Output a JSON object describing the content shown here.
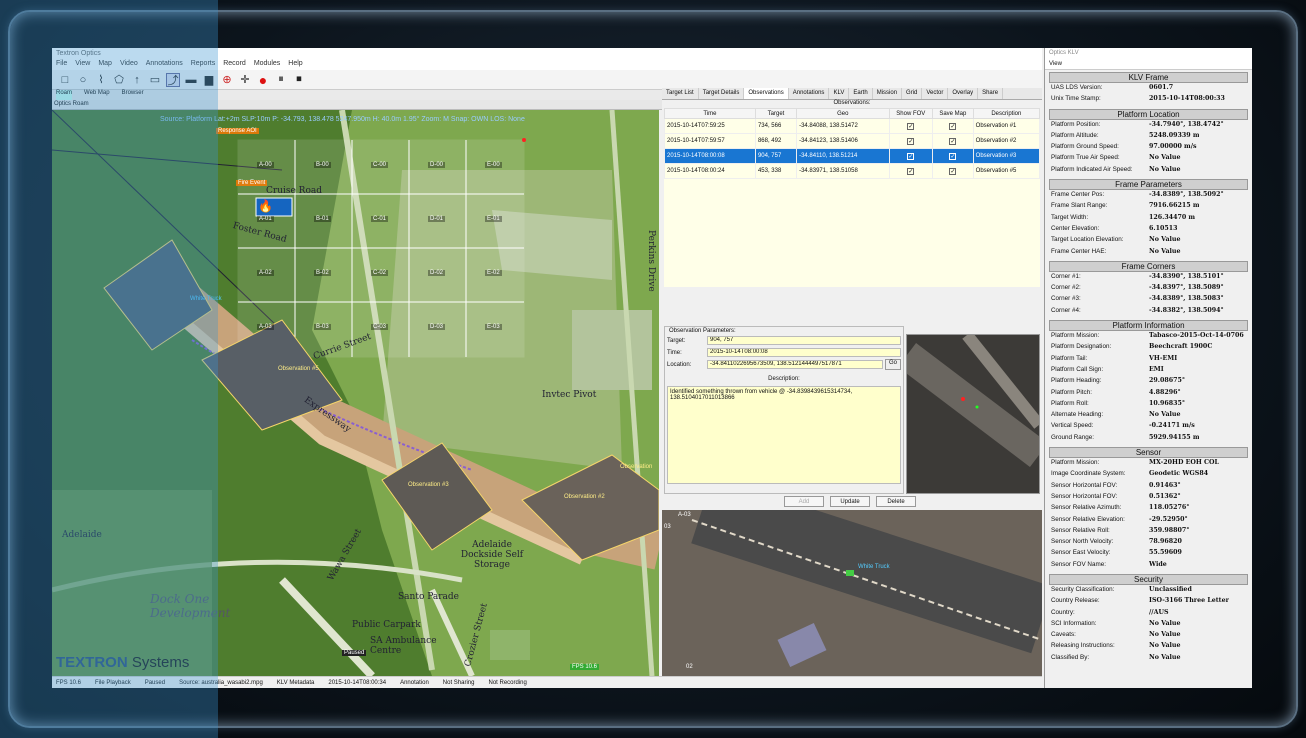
{
  "window": {
    "title": "Textron Optics",
    "menu": [
      "File",
      "View",
      "Map",
      "Video",
      "Annotations",
      "Reports",
      "Record",
      "Modules",
      "Help"
    ],
    "subtabs": [
      "Roam",
      "Web Map",
      "Browser"
    ],
    "panel_title": "Optics Roam",
    "panel_pin": "#"
  },
  "map": {
    "info": "Source: Platform Lat:+2m SLP:10m P: -34.793, 138.478 5247.950m H: 40.0m 1.95° Zoom: M Snap: OWN LOS: None",
    "response_aoi": "Response AOI",
    "fire_event": "Fire Event",
    "grid_rows": [
      [
        "A-00",
        "B-00",
        "C-00",
        "D-00",
        "E-00"
      ],
      [
        "A-01",
        "B-01",
        "C-01",
        "D-01",
        "E-01"
      ],
      [
        "A-02",
        "B-02",
        "C-02",
        "D-02",
        "E-02"
      ],
      [
        "A-03",
        "B-03",
        "C-03",
        "D-03",
        "E-03"
      ]
    ],
    "white_truck": "White Truck",
    "observations": [
      "Observation #5",
      "Observation #3",
      "Observation #2",
      "Observation"
    ],
    "places": {
      "perkins_drive": "Perkins Drive",
      "intec": "Invtec Pivot",
      "dockside": "Adelaide Dockside Self Storage",
      "dock_one": "Dock One Development",
      "santo": "Santo Parade",
      "ambulance": "SA Ambulance Centre",
      "wawa": "Wawa Street",
      "crozier": "Crozier Street",
      "currie": "Currie Street",
      "expressway": "Expressway",
      "foster": "Foster Road",
      "adelaide": "Adelaide",
      "public": "Public Carpark",
      "cruise": "Cruise Road"
    },
    "paused": "Paused",
    "fps_badge": "FPS 10.6",
    "brand_a": "TEXTRON",
    "brand_b": " Systems"
  },
  "status": [
    "FPS 10.6",
    "File Playback",
    "Paused",
    "Source: australia_wasabi2.mpg",
    "KLV Metadata",
    "2015-10-14T08:00:34",
    "Annotation",
    "Not Sharing",
    "Not Recording"
  ],
  "right": {
    "tabs": [
      "Target List",
      "Target Details",
      "Observations",
      "Annotations",
      "KLV",
      "Earth",
      "Mission",
      "Grid",
      "Vector",
      "Overlay",
      "Share"
    ],
    "active_tab": "Observations",
    "obs_heading": "Observations:",
    "columns": [
      "Time",
      "Target",
      "Geo",
      "Show FOV",
      "Save Map",
      "Description"
    ],
    "rows": [
      {
        "time": "2015-10-14T07:59:25",
        "target": "734, 566",
        "geo": "-34.84088, 138.51472",
        "desc": "Observation #1"
      },
      {
        "time": "2015-10-14T07:59:57",
        "target": "868, 492",
        "geo": "-34.84123, 138.51406",
        "desc": "Observation #2"
      },
      {
        "time": "2015-10-14T08:00:08",
        "target": "904, 757",
        "geo": "-34.84110, 138.51214",
        "desc": "Observation #3"
      },
      {
        "time": "2015-10-14T08:00:24",
        "target": "453, 338",
        "geo": "-34.83971, 138.51058",
        "desc": "Observation #5"
      }
    ],
    "check": "✓",
    "params_legend": "Observation Parameters:",
    "target_label": "Target:",
    "target_value": "904, 757",
    "time_label": "Time:",
    "time_value": "2015-10-14T08:00:08",
    "location_label": "Location:",
    "location_value": "-34.8411022695673509, 138.5121444497517871",
    "go": "Go",
    "desc_label": "Description:",
    "desc_value": "Identified something thrown from vehicle @ -34.8398439615314734,\n138.5104017011013866",
    "add": "Add",
    "update": "Update",
    "delete": "Delete",
    "video_labels": [
      "A-03",
      "03",
      "White Truck",
      "02"
    ]
  },
  "klv": {
    "top": "Optics KLV",
    "view": "View",
    "sections": [
      {
        "title": "KLV Frame",
        "rows": [
          [
            "UAS LDS Version:",
            "0601.7"
          ],
          [
            "Unix Time Stamp:",
            "2015-10-14T08:00:33"
          ]
        ]
      },
      {
        "title": "Platform Location",
        "rows": [
          [
            "Platform Position:",
            "-34.7940°, 138.4742°"
          ],
          [
            "Platform Altitude:",
            "5248.09339 m"
          ],
          [
            "Platform Ground Speed:",
            "97.00000 m/s"
          ],
          [
            "Platform True Air Speed:",
            "No Value"
          ],
          [
            "Platform Indicated Air Speed:",
            "No Value"
          ]
        ]
      },
      {
        "title": "Frame Parameters",
        "rows": [
          [
            "Frame Center Pos:",
            "-34.8389°, 138.5092°"
          ],
          [
            "Frame Slant Range:",
            "7916.66215 m"
          ],
          [
            "Target Width:",
            "126.34470 m"
          ],
          [
            "Center Elevation:",
            "6.10513"
          ],
          [
            "Target Location Elevation:",
            "No Value"
          ],
          [
            "Frame Center HAE:",
            "No Value"
          ]
        ]
      },
      {
        "title": "Frame Corners",
        "rows": [
          [
            "Corner #1:",
            "-34.8390°, 138.5101°"
          ],
          [
            "Corner #2:",
            "-34.8397°, 138.5089°"
          ],
          [
            "Corner #3:",
            "-34.8389°, 138.5083°"
          ],
          [
            "Corner #4:",
            "-34.8382°, 138.5094°"
          ]
        ]
      },
      {
        "title": "Platform Information",
        "rows": [
          [
            "Platform Mission:",
            "Tabasco-2015-Oct-14-0706"
          ],
          [
            "Platform Designation:",
            "Beechcraft 1900C"
          ],
          [
            "Platform Tail:",
            "VH-EMI"
          ],
          [
            "Platform Call Sign:",
            "EMI"
          ],
          [
            "Platform Heading:",
            "29.08675°"
          ],
          [
            "Platform Pitch:",
            "4.88296°"
          ],
          [
            "Platform Roll:",
            "10.96835°"
          ],
          [
            "Alternate Heading:",
            "No Value"
          ],
          [
            "Vertical Speed:",
            "-0.24171 m/s"
          ],
          [
            "Ground Range:",
            "5929.94155 m"
          ]
        ]
      },
      {
        "title": "Sensor",
        "rows": [
          [
            "Platform Mission:",
            "MX-20HD EOH COL"
          ],
          [
            "Image Coordinate System:",
            "Geodetic WGS84"
          ],
          [
            "Sensor Horizontal FOV:",
            "0.91463°"
          ],
          [
            "Sensor Horizontal FOV:",
            "0.51362°"
          ],
          [
            "Sensor Relative Azimuth:",
            "118.05276°"
          ],
          [
            "Sensor Relative Elevation:",
            "-29.52950°"
          ],
          [
            "Sensor Relative Roll:",
            "359.98807°"
          ],
          [
            "Sensor North Velocity:",
            "78.96820"
          ],
          [
            "Sensor East Velocity:",
            "55.59609"
          ],
          [
            "Sensor FOV Name:",
            "Wide"
          ]
        ]
      },
      {
        "title": "Security",
        "rows": [
          [
            "Security Classification:",
            "Unclassified"
          ],
          [
            "Country Release:",
            "ISO-3166 Three Letter"
          ],
          [
            "Country:",
            "//AUS"
          ],
          [
            "SCI Information:",
            "No Value"
          ],
          [
            "Caveats:",
            "No Value"
          ],
          [
            "Releasing Instructions:",
            "No Value"
          ],
          [
            "Classified By:",
            "No Value"
          ]
        ]
      }
    ]
  }
}
